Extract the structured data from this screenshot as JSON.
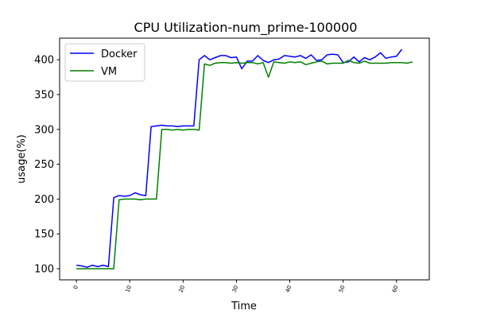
{
  "chart_data": {
    "type": "line",
    "title": "CPU Utilization-num_prime-100000",
    "xlabel": "Time",
    "ylabel": "usage(%)",
    "xlim": [
      -3.15,
      66.15
    ],
    "ylim": [
      84,
      431
    ],
    "xticks": [
      0,
      10,
      20,
      30,
      40,
      50,
      60
    ],
    "yticks": [
      100,
      150,
      200,
      250,
      300,
      350,
      400
    ],
    "grid": false,
    "legend_position": "upper-left",
    "series": [
      {
        "name": "Docker",
        "color": "#0000ff",
        "x": [
          0,
          1,
          2,
          3,
          4,
          5,
          6,
          7,
          8,
          9,
          10,
          11,
          12,
          13,
          14,
          15,
          16,
          17,
          18,
          19,
          20,
          21,
          22,
          23,
          24,
          25,
          26,
          27,
          28,
          29,
          30,
          31,
          32,
          33,
          34,
          35,
          36,
          37,
          38,
          39,
          40,
          41,
          42,
          43,
          44,
          45,
          46,
          47,
          48,
          49,
          50,
          51,
          52,
          53,
          54,
          55,
          56,
          57,
          58,
          59,
          60,
          61
        ],
        "values": [
          105,
          104,
          102,
          105,
          103,
          105,
          103,
          202,
          205,
          204,
          205,
          209,
          206,
          205,
          304,
          305,
          306,
          305,
          305,
          304,
          305,
          305,
          305,
          400,
          406,
          400,
          403,
          406,
          406,
          403,
          404,
          387,
          398,
          398,
          406,
          399,
          396,
          400,
          401,
          406,
          405,
          404,
          406,
          402,
          407,
          399,
          400,
          407,
          408,
          407,
          396,
          397,
          404,
          397,
          403,
          400,
          404,
          410,
          402,
          404,
          405,
          415
        ]
      },
      {
        "name": "VM",
        "color": "#008000",
        "x": [
          0,
          1,
          2,
          3,
          4,
          5,
          6,
          7,
          8,
          9,
          10,
          11,
          12,
          13,
          14,
          15,
          16,
          17,
          18,
          19,
          20,
          21,
          22,
          23,
          24,
          25,
          26,
          27,
          28,
          29,
          30,
          31,
          32,
          33,
          34,
          35,
          36,
          37,
          38,
          39,
          40,
          41,
          42,
          43,
          44,
          45,
          46,
          47,
          48,
          49,
          50,
          51,
          52,
          53,
          54,
          55,
          56,
          57,
          58,
          59,
          60,
          61,
          62,
          63
        ],
        "values": [
          100,
          100,
          100,
          100,
          100,
          100,
          100,
          100,
          199,
          200,
          200,
          200,
          199,
          200,
          200,
          200,
          300,
          300,
          299,
          300,
          299,
          300,
          300,
          299,
          394,
          392,
          395,
          396,
          396,
          395,
          396,
          395,
          396,
          396,
          394,
          396,
          375,
          397,
          396,
          395,
          397,
          396,
          397,
          393,
          395,
          397,
          398,
          394,
          395,
          395,
          395,
          399,
          396,
          395,
          398,
          395,
          395,
          395,
          395,
          396,
          396,
          396,
          395,
          397
        ]
      }
    ]
  }
}
